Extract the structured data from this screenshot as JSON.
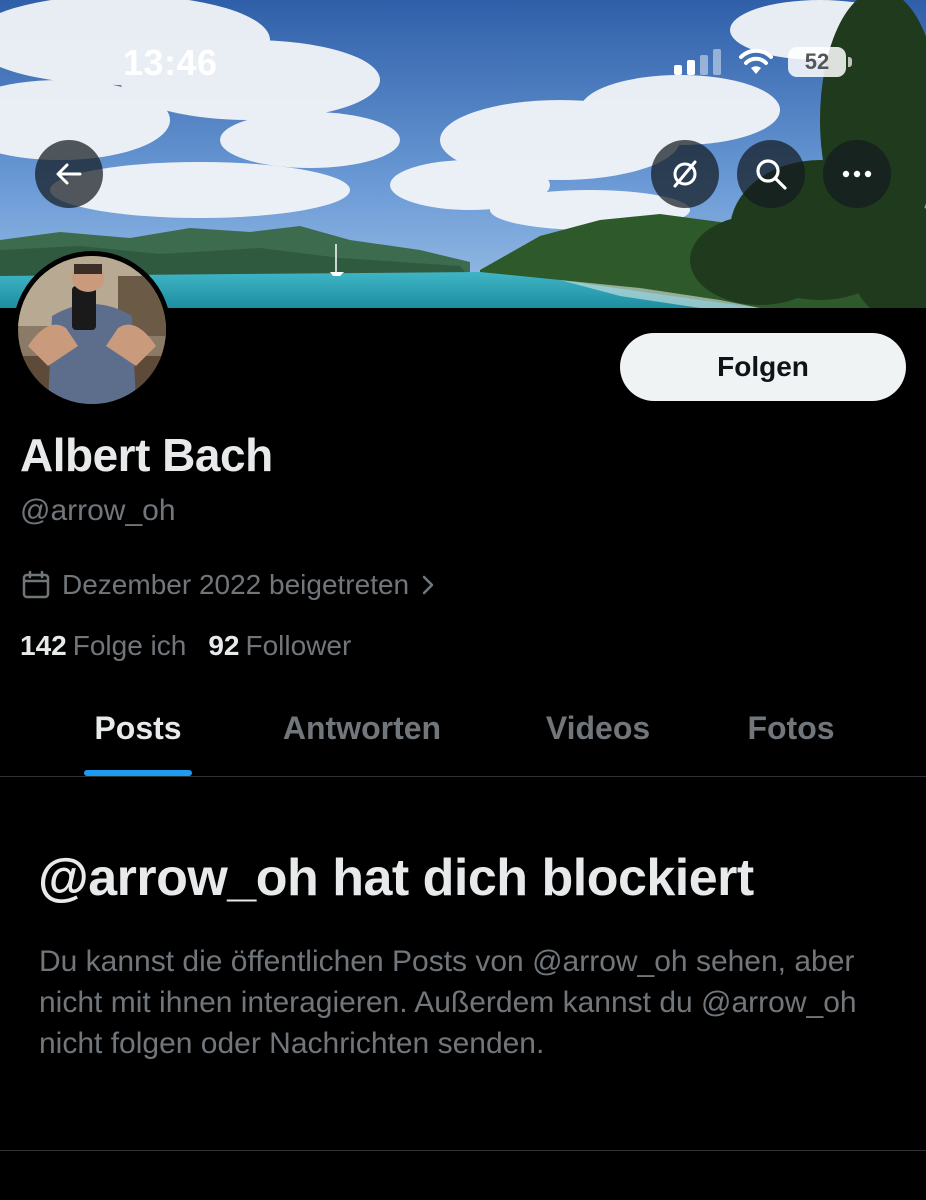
{
  "status_bar": {
    "time": "13:46",
    "battery": "52"
  },
  "header": {
    "back_icon": "arrow-left-icon",
    "notifications_icon": "bell-off-icon",
    "search_icon": "search-icon",
    "more_icon": "ellipsis-icon"
  },
  "profile": {
    "display_name": "Albert Bach",
    "handle": "@arrow_oh",
    "joined": "Dezember 2022 beigetreten",
    "following_count": "142",
    "following_label": "Folge ich",
    "followers_count": "92",
    "followers_label": "Follower",
    "follow_button": "Folgen"
  },
  "tabs": [
    {
      "label": "Posts",
      "active": true
    },
    {
      "label": "Antworten",
      "active": false
    },
    {
      "label": "Videos",
      "active": false
    },
    {
      "label": "Fotos",
      "active": false
    }
  ],
  "blocked_notice": {
    "title": "@arrow_oh hat dich blockiert",
    "body": "Du kannst die öffentlichen Posts von @arrow_oh sehen, aber nicht mit ihnen interagieren. Außerdem kannst du @arrow_oh nicht folgen oder Nachrichten senden."
  },
  "colors": {
    "background": "#000000",
    "text_primary": "#e7e9ea",
    "text_secondary": "#71767b",
    "accent": "#1d9bf0",
    "follow_button_bg": "#eff3f4"
  }
}
